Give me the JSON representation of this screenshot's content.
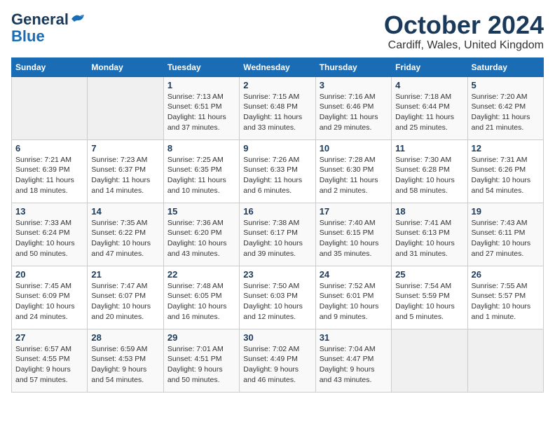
{
  "logo": {
    "general": "General",
    "blue": "Blue"
  },
  "title": "October 2024",
  "subtitle": "Cardiff, Wales, United Kingdom",
  "days_of_week": [
    "Sunday",
    "Monday",
    "Tuesday",
    "Wednesday",
    "Thursday",
    "Friday",
    "Saturday"
  ],
  "weeks": [
    [
      {
        "day": "",
        "empty": true
      },
      {
        "day": "",
        "empty": true
      },
      {
        "day": "1",
        "line1": "Sunrise: 7:13 AM",
        "line2": "Sunset: 6:51 PM",
        "line3": "Daylight: 11 hours",
        "line4": "and 37 minutes."
      },
      {
        "day": "2",
        "line1": "Sunrise: 7:15 AM",
        "line2": "Sunset: 6:48 PM",
        "line3": "Daylight: 11 hours",
        "line4": "and 33 minutes."
      },
      {
        "day": "3",
        "line1": "Sunrise: 7:16 AM",
        "line2": "Sunset: 6:46 PM",
        "line3": "Daylight: 11 hours",
        "line4": "and 29 minutes."
      },
      {
        "day": "4",
        "line1": "Sunrise: 7:18 AM",
        "line2": "Sunset: 6:44 PM",
        "line3": "Daylight: 11 hours",
        "line4": "and 25 minutes."
      },
      {
        "day": "5",
        "line1": "Sunrise: 7:20 AM",
        "line2": "Sunset: 6:42 PM",
        "line3": "Daylight: 11 hours",
        "line4": "and 21 minutes."
      }
    ],
    [
      {
        "day": "6",
        "line1": "Sunrise: 7:21 AM",
        "line2": "Sunset: 6:39 PM",
        "line3": "Daylight: 11 hours",
        "line4": "and 18 minutes."
      },
      {
        "day": "7",
        "line1": "Sunrise: 7:23 AM",
        "line2": "Sunset: 6:37 PM",
        "line3": "Daylight: 11 hours",
        "line4": "and 14 minutes."
      },
      {
        "day": "8",
        "line1": "Sunrise: 7:25 AM",
        "line2": "Sunset: 6:35 PM",
        "line3": "Daylight: 11 hours",
        "line4": "and 10 minutes."
      },
      {
        "day": "9",
        "line1": "Sunrise: 7:26 AM",
        "line2": "Sunset: 6:33 PM",
        "line3": "Daylight: 11 hours",
        "line4": "and 6 minutes."
      },
      {
        "day": "10",
        "line1": "Sunrise: 7:28 AM",
        "line2": "Sunset: 6:30 PM",
        "line3": "Daylight: 11 hours",
        "line4": "and 2 minutes."
      },
      {
        "day": "11",
        "line1": "Sunrise: 7:30 AM",
        "line2": "Sunset: 6:28 PM",
        "line3": "Daylight: 10 hours",
        "line4": "and 58 minutes."
      },
      {
        "day": "12",
        "line1": "Sunrise: 7:31 AM",
        "line2": "Sunset: 6:26 PM",
        "line3": "Daylight: 10 hours",
        "line4": "and 54 minutes."
      }
    ],
    [
      {
        "day": "13",
        "line1": "Sunrise: 7:33 AM",
        "line2": "Sunset: 6:24 PM",
        "line3": "Daylight: 10 hours",
        "line4": "and 50 minutes."
      },
      {
        "day": "14",
        "line1": "Sunrise: 7:35 AM",
        "line2": "Sunset: 6:22 PM",
        "line3": "Daylight: 10 hours",
        "line4": "and 47 minutes."
      },
      {
        "day": "15",
        "line1": "Sunrise: 7:36 AM",
        "line2": "Sunset: 6:20 PM",
        "line3": "Daylight: 10 hours",
        "line4": "and 43 minutes."
      },
      {
        "day": "16",
        "line1": "Sunrise: 7:38 AM",
        "line2": "Sunset: 6:17 PM",
        "line3": "Daylight: 10 hours",
        "line4": "and 39 minutes."
      },
      {
        "day": "17",
        "line1": "Sunrise: 7:40 AM",
        "line2": "Sunset: 6:15 PM",
        "line3": "Daylight: 10 hours",
        "line4": "and 35 minutes."
      },
      {
        "day": "18",
        "line1": "Sunrise: 7:41 AM",
        "line2": "Sunset: 6:13 PM",
        "line3": "Daylight: 10 hours",
        "line4": "and 31 minutes."
      },
      {
        "day": "19",
        "line1": "Sunrise: 7:43 AM",
        "line2": "Sunset: 6:11 PM",
        "line3": "Daylight: 10 hours",
        "line4": "and 27 minutes."
      }
    ],
    [
      {
        "day": "20",
        "line1": "Sunrise: 7:45 AM",
        "line2": "Sunset: 6:09 PM",
        "line3": "Daylight: 10 hours",
        "line4": "and 24 minutes."
      },
      {
        "day": "21",
        "line1": "Sunrise: 7:47 AM",
        "line2": "Sunset: 6:07 PM",
        "line3": "Daylight: 10 hours",
        "line4": "and 20 minutes."
      },
      {
        "day": "22",
        "line1": "Sunrise: 7:48 AM",
        "line2": "Sunset: 6:05 PM",
        "line3": "Daylight: 10 hours",
        "line4": "and 16 minutes."
      },
      {
        "day": "23",
        "line1": "Sunrise: 7:50 AM",
        "line2": "Sunset: 6:03 PM",
        "line3": "Daylight: 10 hours",
        "line4": "and 12 minutes."
      },
      {
        "day": "24",
        "line1": "Sunrise: 7:52 AM",
        "line2": "Sunset: 6:01 PM",
        "line3": "Daylight: 10 hours",
        "line4": "and 9 minutes."
      },
      {
        "day": "25",
        "line1": "Sunrise: 7:54 AM",
        "line2": "Sunset: 5:59 PM",
        "line3": "Daylight: 10 hours",
        "line4": "and 5 minutes."
      },
      {
        "day": "26",
        "line1": "Sunrise: 7:55 AM",
        "line2": "Sunset: 5:57 PM",
        "line3": "Daylight: 10 hours",
        "line4": "and 1 minute."
      }
    ],
    [
      {
        "day": "27",
        "line1": "Sunrise: 6:57 AM",
        "line2": "Sunset: 4:55 PM",
        "line3": "Daylight: 9 hours",
        "line4": "and 57 minutes."
      },
      {
        "day": "28",
        "line1": "Sunrise: 6:59 AM",
        "line2": "Sunset: 4:53 PM",
        "line3": "Daylight: 9 hours",
        "line4": "and 54 minutes."
      },
      {
        "day": "29",
        "line1": "Sunrise: 7:01 AM",
        "line2": "Sunset: 4:51 PM",
        "line3": "Daylight: 9 hours",
        "line4": "and 50 minutes."
      },
      {
        "day": "30",
        "line1": "Sunrise: 7:02 AM",
        "line2": "Sunset: 4:49 PM",
        "line3": "Daylight: 9 hours",
        "line4": "and 46 minutes."
      },
      {
        "day": "31",
        "line1": "Sunrise: 7:04 AM",
        "line2": "Sunset: 4:47 PM",
        "line3": "Daylight: 9 hours",
        "line4": "and 43 minutes."
      },
      {
        "day": "",
        "empty": true
      },
      {
        "day": "",
        "empty": true
      }
    ]
  ]
}
